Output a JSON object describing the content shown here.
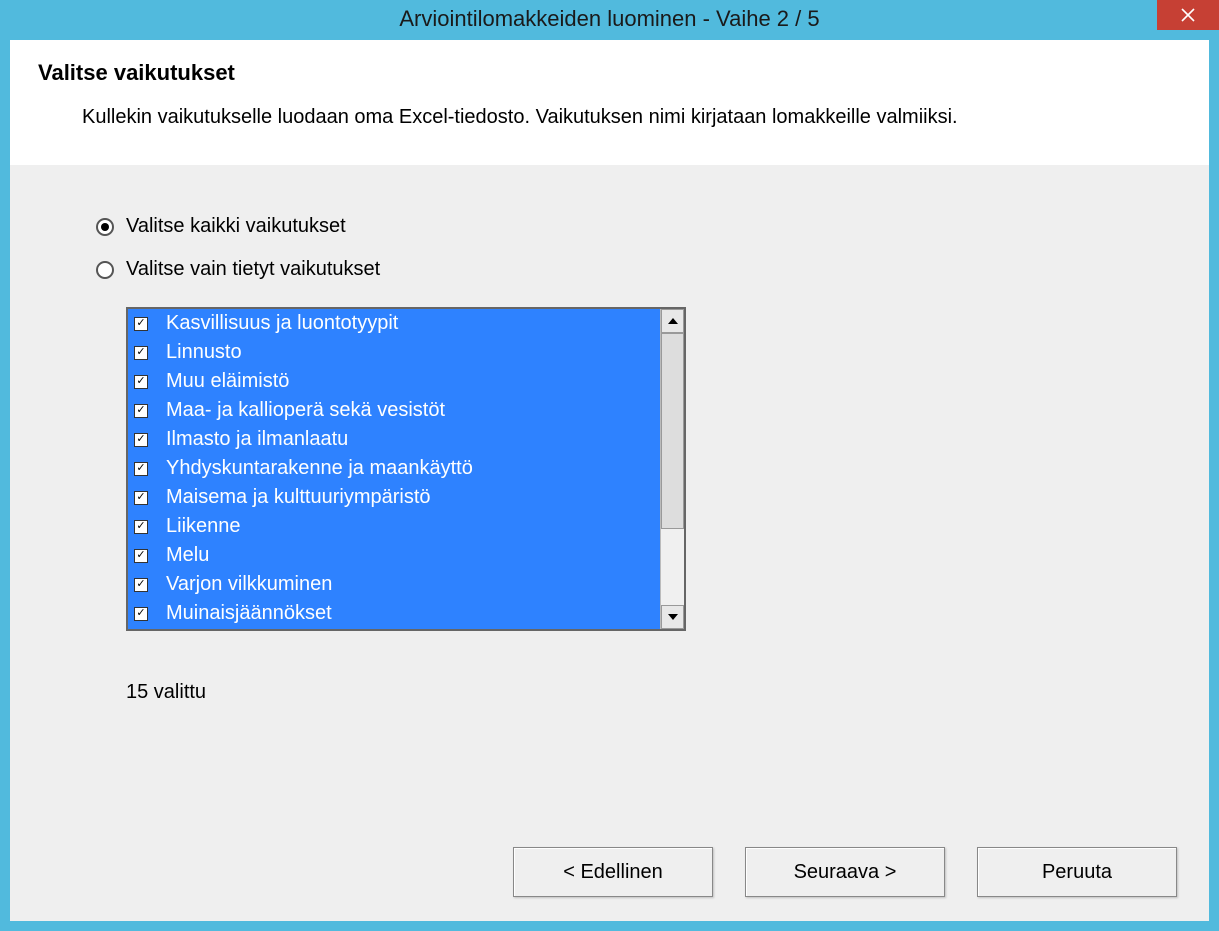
{
  "window": {
    "title": "Arviointilomakkeiden luominen - Vaihe 2 / 5"
  },
  "header": {
    "heading": "Valitse vaikutukset",
    "description": "Kullekin vaikutukselle luodaan oma Excel-tiedosto. Vaikutuksen nimi kirjataan lomakkeille valmiiksi."
  },
  "radios": {
    "select_all": "Valitse kaikki vaikutukset",
    "select_some": "Valitse vain tietyt vaikutukset",
    "selected": "all"
  },
  "list": {
    "items": [
      {
        "label": "Kasvillisuus ja luontotyypit",
        "checked": true
      },
      {
        "label": "Linnusto",
        "checked": true
      },
      {
        "label": "Muu eläimistö",
        "checked": true
      },
      {
        "label": "Maa- ja kallioperä sekä vesistöt",
        "checked": true
      },
      {
        "label": "Ilmasto ja ilmanlaatu",
        "checked": true
      },
      {
        "label": "Yhdyskuntarakenne ja maankäyttö",
        "checked": true
      },
      {
        "label": "Maisema ja kulttuuriympäristö",
        "checked": true
      },
      {
        "label": "Liikenne",
        "checked": true
      },
      {
        "label": "Melu",
        "checked": true
      },
      {
        "label": "Varjon vilkkuminen",
        "checked": true
      },
      {
        "label": "Muinaisjäännökset",
        "checked": true
      }
    ]
  },
  "count_label": "15 valittu",
  "buttons": {
    "prev": "< Edellinen",
    "next": "Seuraava >",
    "cancel": "Peruuta"
  }
}
